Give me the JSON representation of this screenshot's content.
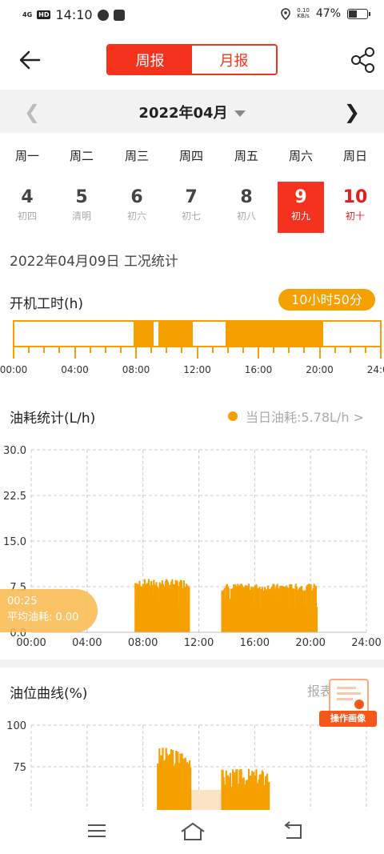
{
  "status": {
    "time": "14:10",
    "signal": "4G",
    "hd": "HD",
    "netspeed_value": "0.10",
    "netspeed_unit": "KB/s",
    "battery": "47%"
  },
  "header": {
    "tab_week": "周报",
    "tab_month": "月报",
    "active_tab": "week"
  },
  "month": {
    "title": "2022年04月"
  },
  "weekdays": [
    "周一",
    "周二",
    "周三",
    "周四",
    "周五",
    "周六",
    "周日"
  ],
  "days": [
    {
      "num": "4",
      "lunar": "初四"
    },
    {
      "num": "5",
      "lunar": "清明"
    },
    {
      "num": "6",
      "lunar": "初六"
    },
    {
      "num": "7",
      "lunar": "初七"
    },
    {
      "num": "8",
      "lunar": "初八"
    },
    {
      "num": "9",
      "lunar": "初九",
      "selected": true
    },
    {
      "num": "10",
      "lunar": "初十",
      "sunday": true
    }
  ],
  "date_title": "2022年04月09日 工况统计",
  "work_hours": {
    "title": "开机工时(h)",
    "total": "10小时50分",
    "on_intervals_hours": [
      [
        7.85,
        9.15
      ],
      [
        9.45,
        11.7
      ],
      [
        13.85,
        20.25
      ]
    ],
    "axis_labels": [
      "00:00",
      "04:00",
      "08:00",
      "12:00",
      "16:00",
      "20:00",
      "24:00"
    ]
  },
  "fuel": {
    "title": "油耗统计(L/h)",
    "today": "当日油耗:5.78L/h >",
    "tooltip_time": "00:25",
    "tooltip_value": "平均油耗: 0.00"
  },
  "level": {
    "title": "油位曲线(%)",
    "report": "报表 >",
    "badge": "操作画像"
  },
  "accent_color": "#f5321e",
  "chart_color": "#f6a000",
  "chart_data": [
    {
      "type": "bar",
      "name": "fuel",
      "ylim": [
        0,
        30
      ],
      "xlim": [
        0,
        24
      ],
      "yticks": [
        "0.0",
        "7.5",
        "15.0",
        "22.5",
        "30.0"
      ],
      "xticks": [
        "00:00",
        "04:00",
        "08:00",
        "12:00",
        "16:00",
        "20:00",
        "24:00"
      ],
      "grid": true,
      "segments": [
        {
          "from": 7.4,
          "to": 11.3,
          "base": 7.2,
          "peak": 8.8
        },
        {
          "from": 13.6,
          "to": 20.4,
          "base": 6.8,
          "peak": 8.0
        }
      ]
    },
    {
      "type": "bar",
      "name": "level",
      "ylim": [
        50,
        100
      ],
      "yticks": [
        "75",
        "100"
      ],
      "grid": true,
      "segments": [
        {
          "from": 9.0,
          "to": 11.4,
          "base": 72,
          "peak": 87
        },
        {
          "from": 13.6,
          "to": 17.0,
          "base": 62,
          "peak": 74
        }
      ],
      "gap": {
        "from": 11.4,
        "to": 13.6,
        "value": 61
      }
    }
  ],
  "nav": {
    "menu": "menu-icon",
    "home": "home-icon",
    "back": "back-icon"
  }
}
